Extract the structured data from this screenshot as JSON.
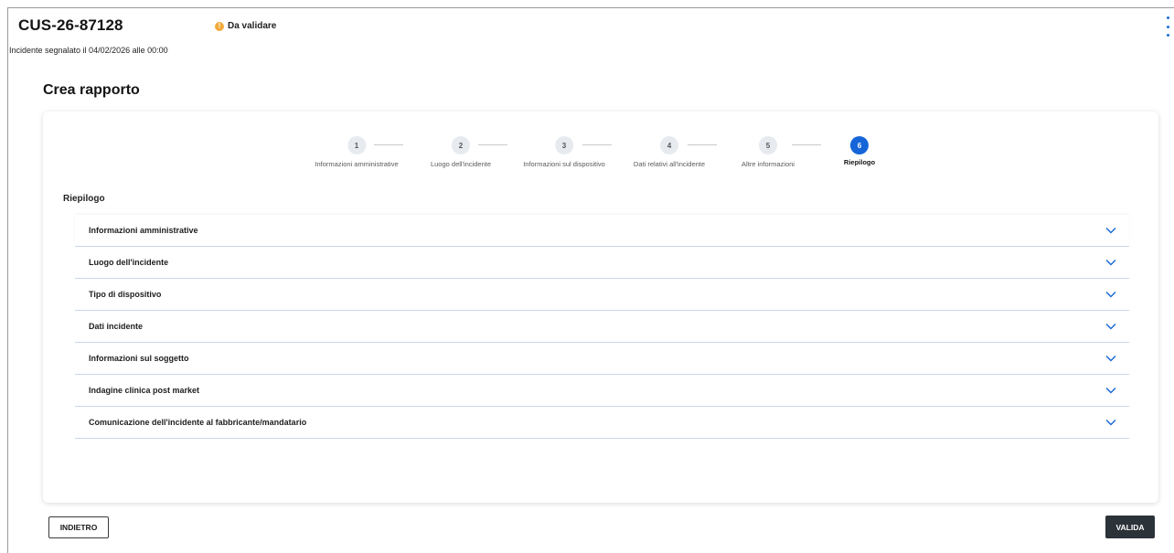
{
  "header": {
    "case_id": "CUS-26-87128",
    "status": {
      "label": "Da validare",
      "icon": "info-icon",
      "color": "#f2a93b",
      "glyph": "!"
    },
    "reported": "Incidente segnalato il 04/02/2026 alle 00:00",
    "menu_icon": "kebab-menu-icon"
  },
  "page": {
    "title": "Crea rapporto"
  },
  "stepper": {
    "active_step": 6,
    "steps": [
      {
        "number": "1",
        "label": "Informazioni amministrative"
      },
      {
        "number": "2",
        "label": "Luogo dell'incidente"
      },
      {
        "number": "3",
        "label": "Informazioni sul dispositivo"
      },
      {
        "number": "4",
        "label": "Dati relativi all'incidente"
      },
      {
        "number": "5",
        "label": "Altre informazioni"
      },
      {
        "number": "6",
        "label": "Riepilogo"
      }
    ]
  },
  "summary": {
    "title": "Riepilogo",
    "sections": [
      {
        "label": "Informazioni amministrative"
      },
      {
        "label": "Luogo dell'incidente"
      },
      {
        "label": "Tipo di dispositivo"
      },
      {
        "label": "Dati incidente"
      },
      {
        "label": "Informazioni sul soggetto"
      },
      {
        "label": "Indagine clinica post market"
      },
      {
        "label": "Comunicazione dell'incidente al fabbricante/mandatario"
      }
    ]
  },
  "actions": {
    "back_label": "INDIETRO",
    "validate_label": "VALIDA"
  },
  "colors": {
    "accent": "#1565d8",
    "primary_button": "#2b3238",
    "divider": "#c7d6ee"
  }
}
